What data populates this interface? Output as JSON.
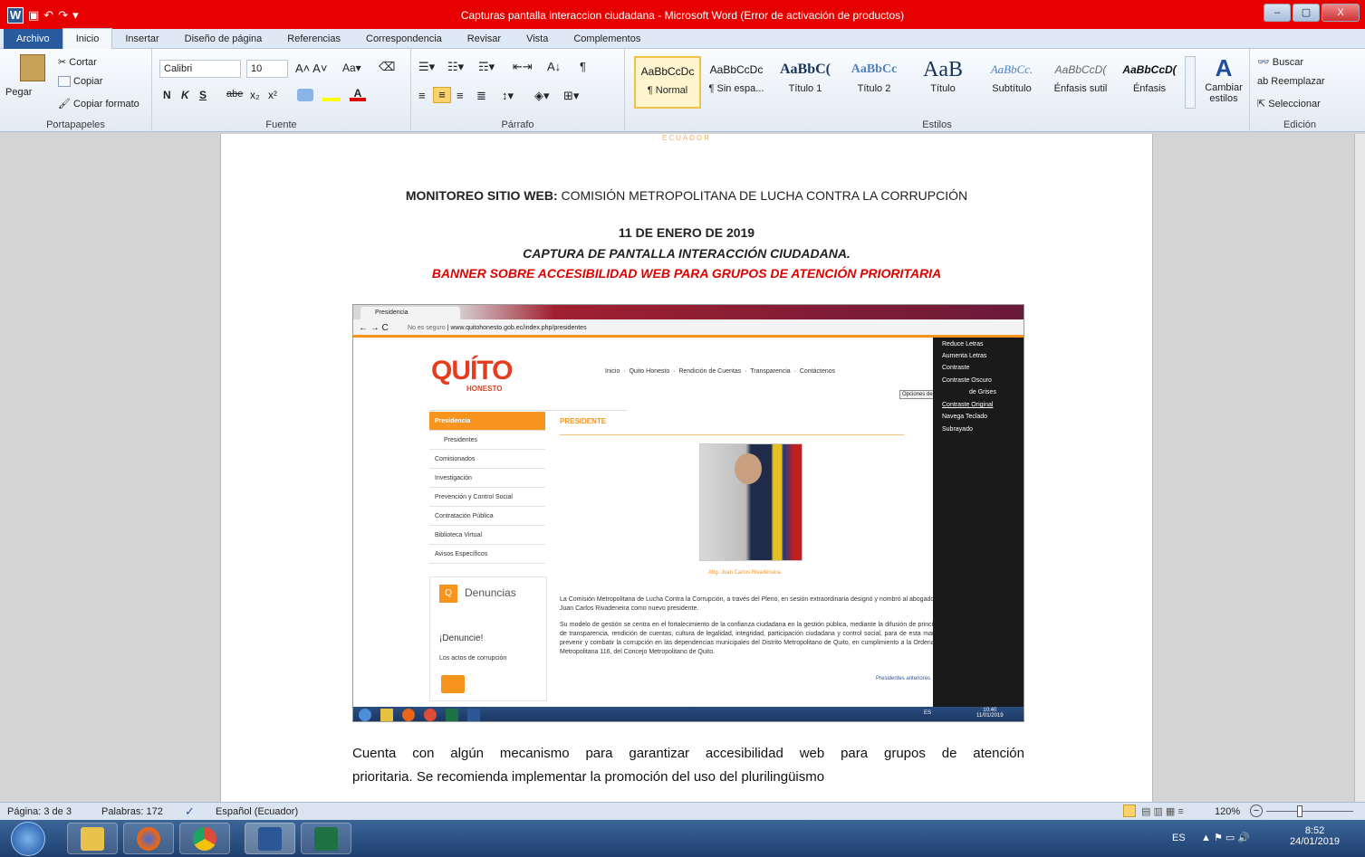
{
  "window": {
    "title": "Capturas pantalla interaccion ciudadana  -  Microsoft Word (Error de activación de productos)",
    "qat_word": "W",
    "min": "–",
    "max": "▢",
    "close": "X"
  },
  "tabs": [
    "Archivo",
    "Inicio",
    "Insertar",
    "Diseño de página",
    "Referencias",
    "Correspondencia",
    "Revisar",
    "Vista",
    "Complementos"
  ],
  "ribbon": {
    "clipboard": {
      "paste": "Pegar",
      "cut": "Cortar",
      "copy": "Copiar",
      "format_painter": "Copiar formato",
      "label": "Portapapeles"
    },
    "font": {
      "name": "Calibri",
      "size": "10",
      "bold": "N",
      "italic": "K",
      "underline": "S",
      "strike": "abe",
      "sub": "x₂",
      "sup": "x²",
      "label": "Fuente"
    },
    "paragraph": {
      "label": "Párrafo"
    },
    "styles": {
      "items": [
        {
          "preview": "AaBbCcDc",
          "name": "¶ Normal"
        },
        {
          "preview": "AaBbCcDc",
          "name": "¶ Sin espa..."
        },
        {
          "preview": "AaBbC(",
          "name": "Título 1"
        },
        {
          "preview": "AaBbCc",
          "name": "Título 2"
        },
        {
          "preview": "AaB",
          "name": "Título"
        },
        {
          "preview": "AaBbCc.",
          "name": "Subtítulo"
        },
        {
          "preview": "AaBbCcD(",
          "name": "Énfasis sutil"
        },
        {
          "preview": "AaBbCcD(",
          "name": "Énfasis"
        }
      ],
      "change": "Cambiar estilos",
      "label": "Estilos"
    },
    "editing": {
      "find": "Buscar",
      "replace": "Reemplazar",
      "select": "Seleccionar",
      "label": "Edición"
    }
  },
  "doc": {
    "header_logo": "ECUADOR",
    "line1_bold": "MONITOREO SITIO WEB:",
    "line1_rest": " COMISIÓN METROPOLITANA DE LUCHA CONTRA LA CORRUPCIÓN",
    "date": "11 DE ENERO DE 2019",
    "subtitle": "CAPTURA DE PANTALLA INTERACCIÓN CIUDADANA.",
    "banner": "BANNER SOBRE ACCESIBILIDAD WEB PARA GRUPOS DE ATENCIÓN PRIORITARIA",
    "body1": "Cuenta con algún mecanismo para garantizar accesibilidad web para grupos de atención",
    "body2": "prioritaria. Se recomienda implementar la promoción del uso del plurilingüismo"
  },
  "screenshot": {
    "tab_title": "Presidencia",
    "url_secure": "No es seguro",
    "url": "www.quitohonesto.gob.ec/index.php/presidentes",
    "logo_big": "QUÍTO",
    "logo_small": "HONESTO",
    "nav": [
      "Inicio",
      "Quito Honesto",
      "Rendición de Cuentas",
      "Transparencia",
      "Contáctenos"
    ],
    "tooltip": "Opciones de Accesibilidad",
    "sidebar": [
      "Presidencia",
      "Presidentes",
      "Comisionados",
      "Investigación",
      "Prevención y Control Social",
      "Contratación Pública",
      "Biblioteca Virtual",
      "Avisos Específicos"
    ],
    "heading": "PRESIDENTE",
    "caption": "Abg. Juan Carlos Rivadeneira",
    "denuncias": "Denuncias",
    "denuncie": "¡Denuncie!",
    "actos": "Los actos de corrupción",
    "p1": "La Comisión Metropolitana de Lucha Contra la Corrupción, a través del Pleno, en sesión extraordinaria designó y nombró al abogado Juan Carlos Rivadeneira como nuevo presidente.",
    "p2": "Su modelo de gestión se centra en el fortalecimiento de la confianza ciudadana en la gestión pública, mediante la difusión de principios de transparencia, rendición de cuentas, cultura de legalidad, integridad, participación ciudadana y control social, para de esta manera prevenir y combatir la corrupción en las dependencias municipales del Distrito Metropolitano de Quito, en cumplimiento a la Ordenanza Metropolitana 116, del Concejo Metropolitano de Quito.",
    "prev_link": "Presidentes anteriores",
    "access_menu": [
      "Reduce Letras",
      "Aumenta Letras",
      "Contraste",
      "Contraste Oscuro",
      "de Grises",
      "Contraste Original",
      "Navega Teclado",
      "Subrayado"
    ],
    "tray_lang": "ES",
    "tray_time": "10:40",
    "tray_date": "11/01/2019"
  },
  "status": {
    "page": "Página: 3 de 3",
    "words": "Palabras: 172",
    "lang": "Español (Ecuador)",
    "zoom": "120%"
  },
  "taskbar": {
    "lang": "ES",
    "time": "8:52",
    "date": "24/01/2019"
  }
}
